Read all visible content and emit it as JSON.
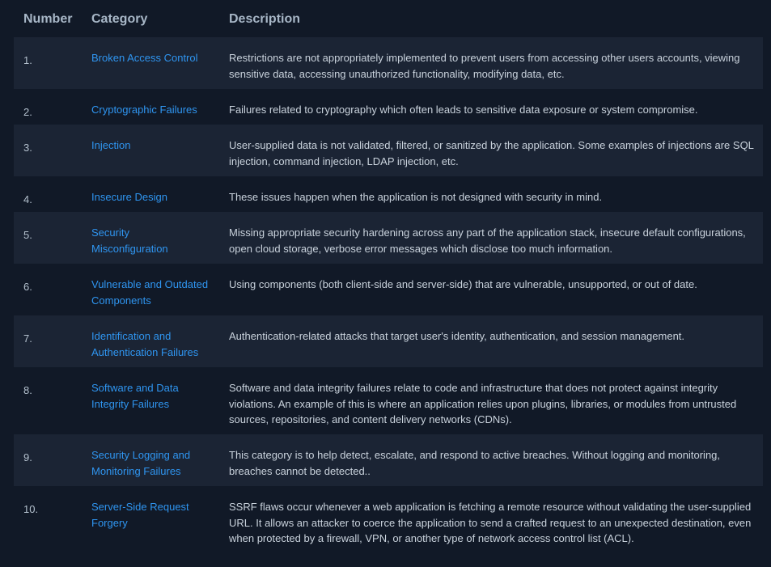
{
  "headers": {
    "number": "Number",
    "category": "Category",
    "description": "Description"
  },
  "rows": [
    {
      "number": "1.",
      "category": "Broken Access Control",
      "description": "Restrictions are not appropriately implemented to prevent users from accessing other users accounts, viewing sensitive data, accessing unauthorized functionality, modifying data, etc."
    },
    {
      "number": "2.",
      "category": "Cryptographic Failures",
      "description": "Failures related to cryptography which often leads to sensitive data exposure or system compromise."
    },
    {
      "number": "3.",
      "category": "Injection",
      "description": "User-supplied data is not validated, filtered, or sanitized by the application. Some examples of injections are SQL injection, command injection, LDAP injection, etc."
    },
    {
      "number": "4.",
      "category": "Insecure Design",
      "description": "These issues happen when the application is not designed with security in mind."
    },
    {
      "number": "5.",
      "category": "Security Misconfiguration",
      "description": "Missing appropriate security hardening across any part of the application stack, insecure default configurations, open cloud storage, verbose error messages which disclose too much information."
    },
    {
      "number": "6.",
      "category": "Vulnerable and Outdated Components",
      "description": "Using components (both client-side and server-side) that are vulnerable, unsupported, or out of date."
    },
    {
      "number": "7.",
      "category": "Identification and Authentication Failures",
      "description": "Authentication-related attacks that target user's identity, authentication, and session management."
    },
    {
      "number": "8.",
      "category": "Software and Data Integrity Failures",
      "description": "Software and data integrity failures relate to code and infrastructure that does not protect against integrity violations. An example of this is where an application relies upon plugins, libraries, or modules from untrusted sources, repositories, and content delivery networks (CDNs)."
    },
    {
      "number": "9.",
      "category": "Security Logging and Monitoring Failures",
      "description": "This category is to help detect, escalate, and respond to active breaches. Without logging and monitoring, breaches cannot be detected.."
    },
    {
      "number": "10.",
      "category": "Server-Side Request Forgery",
      "description": "SSRF flaws occur whenever a web application is fetching a remote resource without validating the user-supplied URL. It allows an attacker to coerce the application to send a crafted request to an unexpected destination, even when protected by a firewall, VPN, or another type of network access control list (ACL)."
    }
  ]
}
